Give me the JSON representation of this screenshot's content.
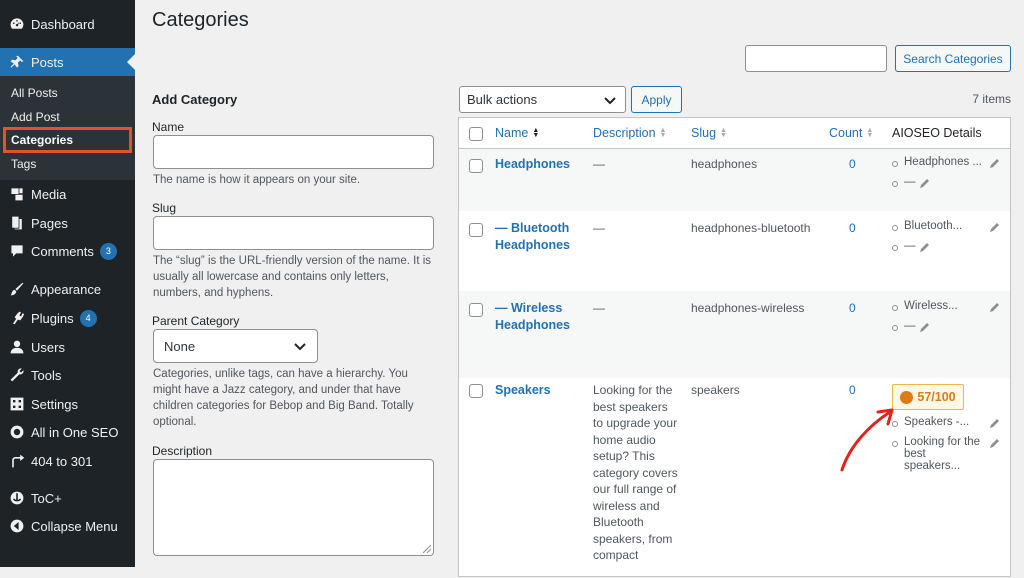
{
  "sidebar": {
    "items": [
      {
        "label": "Dashboard",
        "icon": "dashboard-icon"
      },
      {
        "label": "Posts",
        "icon": "pin-icon"
      },
      {
        "label": "Media",
        "icon": "media-icon"
      },
      {
        "label": "Pages",
        "icon": "pages-icon"
      },
      {
        "label": "Comments",
        "icon": "comments-icon",
        "badge": "3"
      },
      {
        "label": "Appearance",
        "icon": "brush-icon"
      },
      {
        "label": "Plugins",
        "icon": "plugin-icon",
        "badge": "4"
      },
      {
        "label": "Users",
        "icon": "user-icon"
      },
      {
        "label": "Tools",
        "icon": "wrench-icon"
      },
      {
        "label": "Settings",
        "icon": "settings-icon"
      },
      {
        "label": "All in One SEO",
        "icon": "aioseo-icon"
      },
      {
        "label": "404 to 301",
        "icon": "redirect-icon"
      },
      {
        "label": "ToC+",
        "icon": "anchor-icon"
      },
      {
        "label": "Collapse Menu",
        "icon": "collapse-icon"
      }
    ],
    "submenu": [
      "All Posts",
      "Add Post",
      "Categories",
      "Tags"
    ]
  },
  "page": {
    "title": "Categories"
  },
  "search": {
    "button": "Search Categories",
    "value": ""
  },
  "form": {
    "heading": "Add Category",
    "name_label": "Name",
    "name_help": "The name is how it appears on your site.",
    "slug_label": "Slug",
    "slug_help": "The “slug” is the URL-friendly version of the name. It is usually all lowercase and contains only letters, numbers, and hyphens.",
    "parent_label": "Parent Category",
    "parent_value": "None",
    "parent_help": "Categories, unlike tags, can have a hierarchy. You might have a Jazz category, and under that have children categories for Bebop and Big Band. Totally optional.",
    "description_label": "Description"
  },
  "table": {
    "bulk_actions": "Bulk actions",
    "apply": "Apply",
    "items_count": "7 items",
    "columns": {
      "name": "Name",
      "description": "Description",
      "slug": "Slug",
      "count": "Count",
      "aioseo": "AIOSEO Details"
    },
    "rows": [
      {
        "name": "Headphones",
        "description": "—",
        "slug": "headphones",
        "count": "0",
        "aioseo_title": "Headphones ...",
        "aioseo_desc": "—"
      },
      {
        "name": "— Bluetooth Headphones",
        "description": "—",
        "slug": "headphones-bluetooth",
        "count": "0",
        "aioseo_title": "Bluetooth...",
        "aioseo_desc": "—"
      },
      {
        "name": "— Wireless Headphones",
        "description": "—",
        "slug": "headphones-wireless",
        "count": "0",
        "aioseo_title": "Wireless...",
        "aioseo_desc": "—"
      },
      {
        "name": "Speakers",
        "description": "Looking for the best speakers to upgrade your home audio setup? This category covers our full range of wireless and Bluetooth speakers, from compact",
        "slug": "speakers",
        "count": "0",
        "score": "57/100",
        "aioseo_title": "Speakers -...",
        "aioseo_desc": "Looking for the best speakers..."
      }
    ]
  },
  "colors": {
    "sidebar_bg": "#1d2327",
    "accent": "#2271b1",
    "highlight": "#e4512a",
    "score": "#df7a17"
  }
}
